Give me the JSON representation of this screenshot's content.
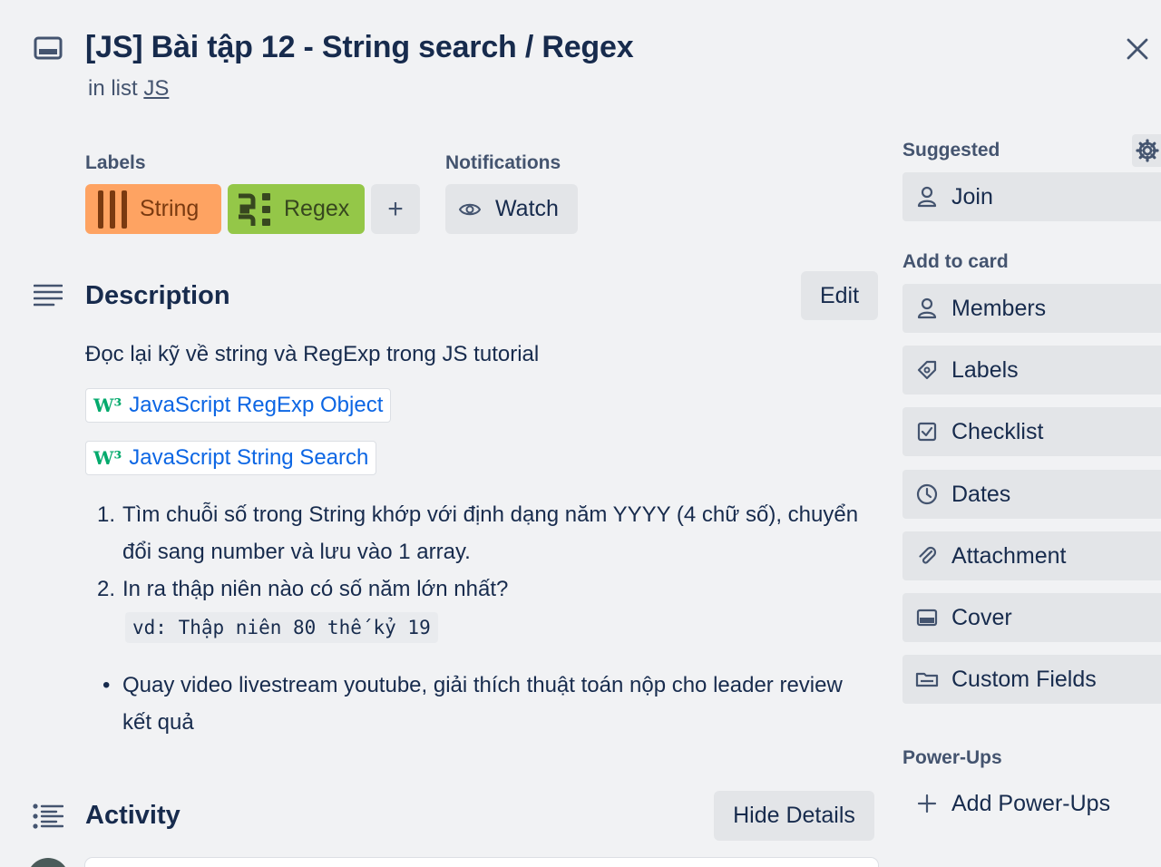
{
  "header": {
    "title": "[JS] Bài tập 12 - String search / Regex",
    "in_list_prefix": "in list",
    "list_name": "JS"
  },
  "labels_section": {
    "heading": "Labels",
    "labels": [
      {
        "name": "String",
        "color": "#fea362"
      },
      {
        "name": "Regex",
        "color": "#94c748"
      }
    ],
    "add_label": "+"
  },
  "notifications": {
    "heading": "Notifications",
    "watch_label": "Watch"
  },
  "description": {
    "heading": "Description",
    "edit_label": "Edit",
    "intro": "Đọc lại kỹ về string và RegExp trong JS tutorial",
    "links": [
      {
        "text": "JavaScript RegExp Object",
        "favicon": "W³"
      },
      {
        "text": "JavaScript String Search",
        "favicon": "W³"
      }
    ],
    "ordered": [
      {
        "marker": "1.",
        "lines": [
          "Tìm chuỗi số trong String khớp với định dạng năm YYYY (4 chữ số), chuyển",
          "đổi sang number và lưu vào 1 array."
        ]
      },
      {
        "marker": "2.",
        "lines": [
          "In ra thập niên nào có số năm lớn nhất?"
        ],
        "code": "vd: Thập niên 80 thế kỷ 19"
      }
    ],
    "bullets": [
      {
        "marker": "•",
        "lines": [
          "Quay video livestream youtube, giải thích thuật toán nộp cho leader review",
          "kết quả"
        ]
      }
    ]
  },
  "activity": {
    "heading": "Activity",
    "hide_details_label": "Hide Details"
  },
  "sidebar": {
    "suggested_heading": "Suggested",
    "join_label": "Join",
    "add_to_card_heading": "Add to card",
    "items": [
      {
        "label": "Members",
        "icon": "person-icon"
      },
      {
        "label": "Labels",
        "icon": "tag-icon"
      },
      {
        "label": "Checklist",
        "icon": "checkbox-icon"
      },
      {
        "label": "Dates",
        "icon": "clock-icon"
      },
      {
        "label": "Attachment",
        "icon": "paperclip-icon"
      },
      {
        "label": "Cover",
        "icon": "cover-icon"
      },
      {
        "label": "Custom Fields",
        "icon": "custom-fields-icon"
      }
    ],
    "powerups_heading": "Power-Ups",
    "add_powerups_label": "Add Power-Ups"
  },
  "colors": {
    "background": "#f1f2f4",
    "button_gray": "#e3e5e8",
    "link_blue": "#0c66e4",
    "text_dark": "#172b4d",
    "text_subtle": "#44546f"
  }
}
